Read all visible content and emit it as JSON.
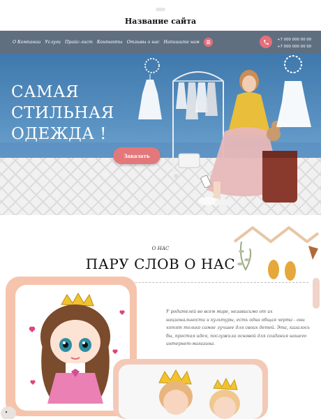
{
  "header": {
    "site_name": "Название сайта"
  },
  "nav": {
    "items": [
      "О Компании",
      "Услуги",
      "Прайс-лист",
      "Контакты",
      "Отзывы о нас",
      "Напишите нам"
    ],
    "phones": [
      "+7 000 000 00 00",
      "+7 000 000 00 00"
    ]
  },
  "hero": {
    "title_lines": [
      "САМАЯ",
      "СТИЛЬНАЯ",
      "ОДЕЖДА !"
    ],
    "button_label": "Заказать"
  },
  "about": {
    "eyebrow": "О НАС",
    "title": "ПАРУ СЛОВ О НАС",
    "text": "У родителей во всем мире, независимо от их национальности и культуры, есть одна общая черта - они хотят только самое лучшее для своих детей. Эта, казалось бы, простая идея, послужила основой для создания нашего интернет-магазина."
  },
  "icons": {
    "phone": "phone-icon",
    "more": "menu-icon"
  },
  "colors": {
    "nav_bg": "#5f6f80",
    "accent": "#e56f7b",
    "hero_wall": "#4d83b4"
  }
}
